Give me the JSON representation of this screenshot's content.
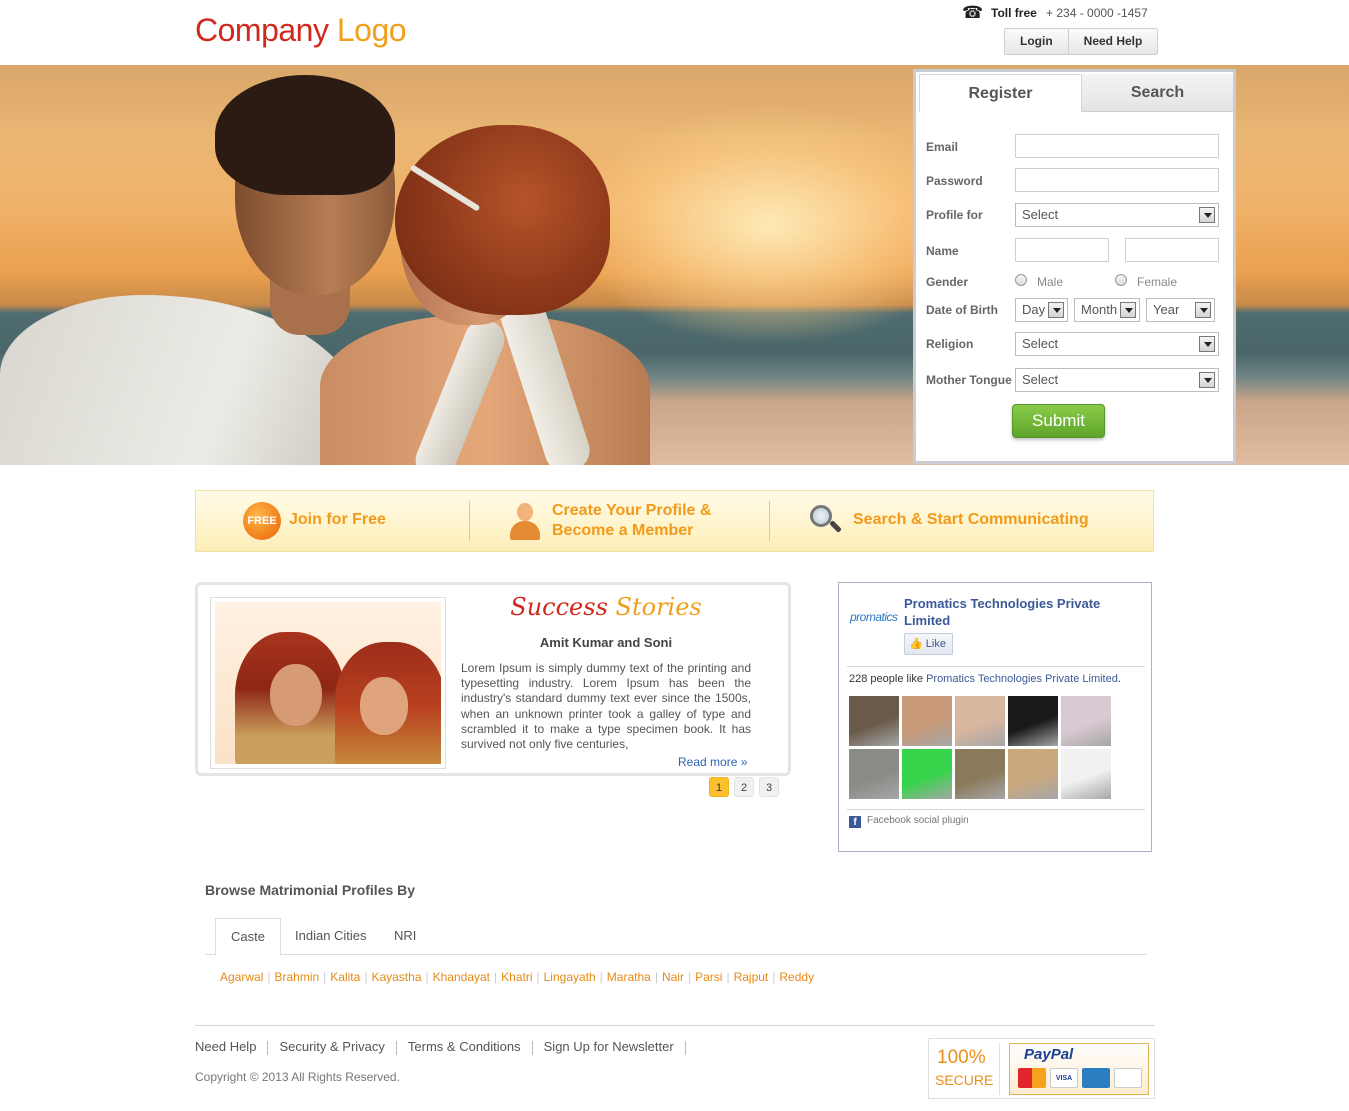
{
  "header": {
    "logo_part1": "Company",
    "logo_part2": "Logo",
    "phone_icon": "☎",
    "toll_label": "Toll free",
    "toll_number": "+ 234 - 0000 -1457",
    "login_label": "Login",
    "help_label": "Need Help"
  },
  "register": {
    "tab_register": "Register",
    "tab_search": "Search",
    "email_label": "Email",
    "password_label": "Password",
    "profile_for_label": "Profile for",
    "profile_for_value": "Select",
    "name_label": "Name",
    "gender_label": "Gender",
    "gender_male": "Male",
    "gender_female": "Female",
    "dob_label": "Date of Birth",
    "dob_day": "Day",
    "dob_month": "Month",
    "dob_year": "Year",
    "religion_label": "Religion",
    "religion_value": "Select",
    "mother_tongue_label": "Mother Tongue",
    "mother_tongue_value": "Select",
    "submit_label": "Submit"
  },
  "steps": {
    "free_badge": "FREE",
    "join": "Join for Free",
    "create_line1": "Create Your Profile &",
    "create_line2": "Become a Member",
    "search": "Search & Start Communicating"
  },
  "stories": {
    "title_part1": "Success",
    "title_part2": "Stories",
    "couple": "Amit Kumar and Soni",
    "text": "Lorem Ipsum is simply dummy text of the printing and typesetting industry. Lorem Ipsum has been the industry's standard dummy text ever since the 1500s, when an unknown printer took a galley of type and scrambled it to make a type specimen book. It has survived not only five centuries,",
    "read_more": "Read more »",
    "pages": [
      "1",
      "2",
      "3"
    ]
  },
  "facebook": {
    "logo_text": "promatics",
    "page_name": "Promatics Technologies Private Limited",
    "like_label": "Like",
    "count_prefix": "228 people like ",
    "count_link": "Promatics Technologies Private Limited",
    "count_suffix": ".",
    "plugin_label": "Facebook social plugin",
    "face_colors": [
      "#6a5a4a",
      "#c89a7a",
      "#d8b6a0",
      "#1a1a1a",
      "#d9c9d2",
      "#8a8a86",
      "#37d44b",
      "#8a7a5a",
      "#c9a87e",
      "#f1f1f1"
    ]
  },
  "browse": {
    "title": "Browse Matrimonial Profiles By",
    "tabs": [
      "Caste",
      "Indian Cities",
      "NRI"
    ],
    "castes": [
      "Agarwal",
      "Brahmin",
      "Kalita",
      "Kayastha",
      "Khandayat",
      "Khatri",
      "Lingayath",
      "Maratha",
      "Nair",
      "Parsi",
      "Rajput",
      "Reddy"
    ]
  },
  "footer": {
    "links": [
      "Need Help",
      "Security & Privacy",
      "Terms & Conditions",
      "Sign Up for Newsletter"
    ],
    "copyright": "Copyright © 2013 All Rights Reserved.",
    "secure_pct": "100%",
    "secure_word": "SECURE",
    "paypal": "PayPal",
    "cards": [
      "MasterCard",
      "VISA",
      "AMEX",
      "DISCOVER"
    ]
  },
  "colors": {
    "accent_orange": "#f29a1a",
    "logo_red": "#d02a1e",
    "submit_green": "#5ea52a",
    "fb_blue": "#3b5998"
  }
}
